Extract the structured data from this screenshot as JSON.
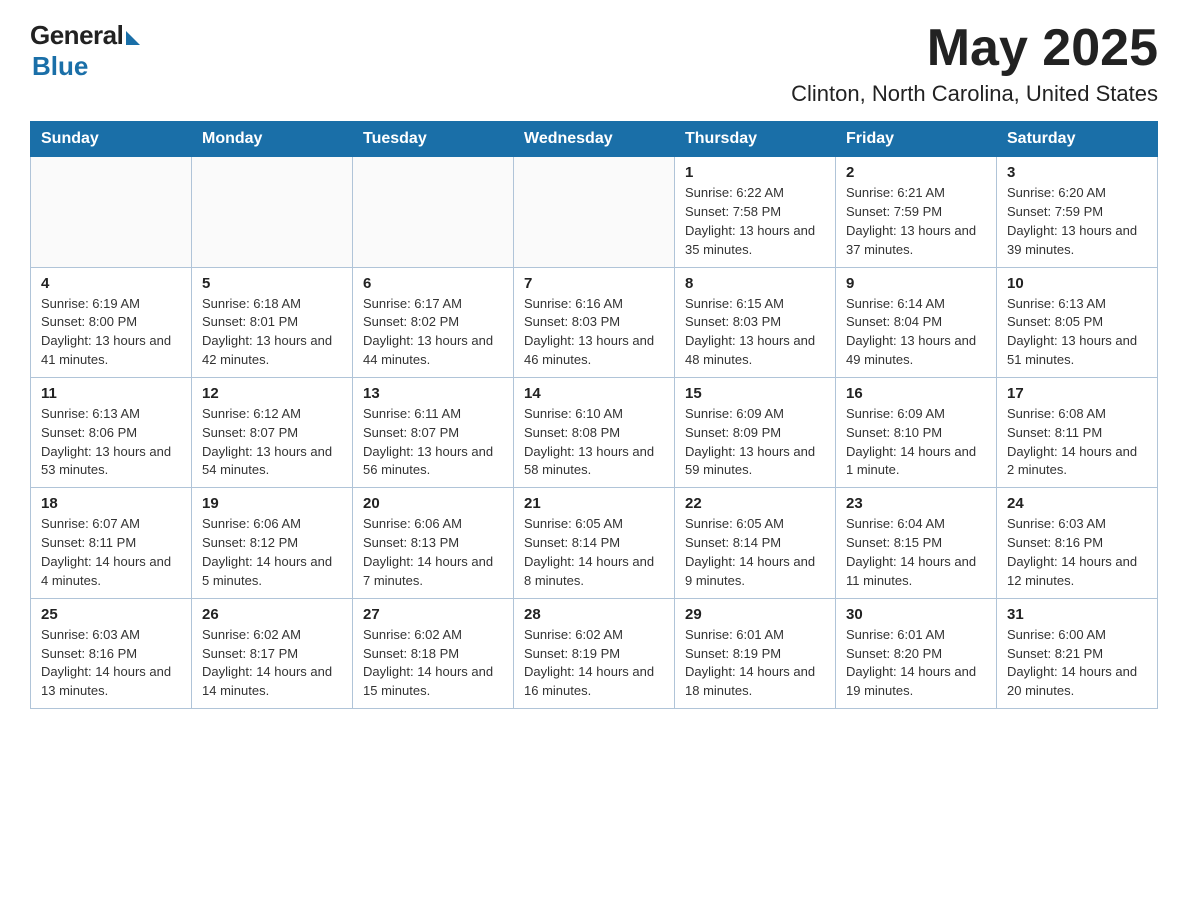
{
  "header": {
    "logo_general": "General",
    "logo_blue": "Blue",
    "month_title": "May 2025",
    "location": "Clinton, North Carolina, United States"
  },
  "weekdays": [
    "Sunday",
    "Monday",
    "Tuesday",
    "Wednesday",
    "Thursday",
    "Friday",
    "Saturday"
  ],
  "weeks": [
    [
      {
        "day": "",
        "info": ""
      },
      {
        "day": "",
        "info": ""
      },
      {
        "day": "",
        "info": ""
      },
      {
        "day": "",
        "info": ""
      },
      {
        "day": "1",
        "info": "Sunrise: 6:22 AM\nSunset: 7:58 PM\nDaylight: 13 hours and 35 minutes."
      },
      {
        "day": "2",
        "info": "Sunrise: 6:21 AM\nSunset: 7:59 PM\nDaylight: 13 hours and 37 minutes."
      },
      {
        "day": "3",
        "info": "Sunrise: 6:20 AM\nSunset: 7:59 PM\nDaylight: 13 hours and 39 minutes."
      }
    ],
    [
      {
        "day": "4",
        "info": "Sunrise: 6:19 AM\nSunset: 8:00 PM\nDaylight: 13 hours and 41 minutes."
      },
      {
        "day": "5",
        "info": "Sunrise: 6:18 AM\nSunset: 8:01 PM\nDaylight: 13 hours and 42 minutes."
      },
      {
        "day": "6",
        "info": "Sunrise: 6:17 AM\nSunset: 8:02 PM\nDaylight: 13 hours and 44 minutes."
      },
      {
        "day": "7",
        "info": "Sunrise: 6:16 AM\nSunset: 8:03 PM\nDaylight: 13 hours and 46 minutes."
      },
      {
        "day": "8",
        "info": "Sunrise: 6:15 AM\nSunset: 8:03 PM\nDaylight: 13 hours and 48 minutes."
      },
      {
        "day": "9",
        "info": "Sunrise: 6:14 AM\nSunset: 8:04 PM\nDaylight: 13 hours and 49 minutes."
      },
      {
        "day": "10",
        "info": "Sunrise: 6:13 AM\nSunset: 8:05 PM\nDaylight: 13 hours and 51 minutes."
      }
    ],
    [
      {
        "day": "11",
        "info": "Sunrise: 6:13 AM\nSunset: 8:06 PM\nDaylight: 13 hours and 53 minutes."
      },
      {
        "day": "12",
        "info": "Sunrise: 6:12 AM\nSunset: 8:07 PM\nDaylight: 13 hours and 54 minutes."
      },
      {
        "day": "13",
        "info": "Sunrise: 6:11 AM\nSunset: 8:07 PM\nDaylight: 13 hours and 56 minutes."
      },
      {
        "day": "14",
        "info": "Sunrise: 6:10 AM\nSunset: 8:08 PM\nDaylight: 13 hours and 58 minutes."
      },
      {
        "day": "15",
        "info": "Sunrise: 6:09 AM\nSunset: 8:09 PM\nDaylight: 13 hours and 59 minutes."
      },
      {
        "day": "16",
        "info": "Sunrise: 6:09 AM\nSunset: 8:10 PM\nDaylight: 14 hours and 1 minute."
      },
      {
        "day": "17",
        "info": "Sunrise: 6:08 AM\nSunset: 8:11 PM\nDaylight: 14 hours and 2 minutes."
      }
    ],
    [
      {
        "day": "18",
        "info": "Sunrise: 6:07 AM\nSunset: 8:11 PM\nDaylight: 14 hours and 4 minutes."
      },
      {
        "day": "19",
        "info": "Sunrise: 6:06 AM\nSunset: 8:12 PM\nDaylight: 14 hours and 5 minutes."
      },
      {
        "day": "20",
        "info": "Sunrise: 6:06 AM\nSunset: 8:13 PM\nDaylight: 14 hours and 7 minutes."
      },
      {
        "day": "21",
        "info": "Sunrise: 6:05 AM\nSunset: 8:14 PM\nDaylight: 14 hours and 8 minutes."
      },
      {
        "day": "22",
        "info": "Sunrise: 6:05 AM\nSunset: 8:14 PM\nDaylight: 14 hours and 9 minutes."
      },
      {
        "day": "23",
        "info": "Sunrise: 6:04 AM\nSunset: 8:15 PM\nDaylight: 14 hours and 11 minutes."
      },
      {
        "day": "24",
        "info": "Sunrise: 6:03 AM\nSunset: 8:16 PM\nDaylight: 14 hours and 12 minutes."
      }
    ],
    [
      {
        "day": "25",
        "info": "Sunrise: 6:03 AM\nSunset: 8:16 PM\nDaylight: 14 hours and 13 minutes."
      },
      {
        "day": "26",
        "info": "Sunrise: 6:02 AM\nSunset: 8:17 PM\nDaylight: 14 hours and 14 minutes."
      },
      {
        "day": "27",
        "info": "Sunrise: 6:02 AM\nSunset: 8:18 PM\nDaylight: 14 hours and 15 minutes."
      },
      {
        "day": "28",
        "info": "Sunrise: 6:02 AM\nSunset: 8:19 PM\nDaylight: 14 hours and 16 minutes."
      },
      {
        "day": "29",
        "info": "Sunrise: 6:01 AM\nSunset: 8:19 PM\nDaylight: 14 hours and 18 minutes."
      },
      {
        "day": "30",
        "info": "Sunrise: 6:01 AM\nSunset: 8:20 PM\nDaylight: 14 hours and 19 minutes."
      },
      {
        "day": "31",
        "info": "Sunrise: 6:00 AM\nSunset: 8:21 PM\nDaylight: 14 hours and 20 minutes."
      }
    ]
  ]
}
